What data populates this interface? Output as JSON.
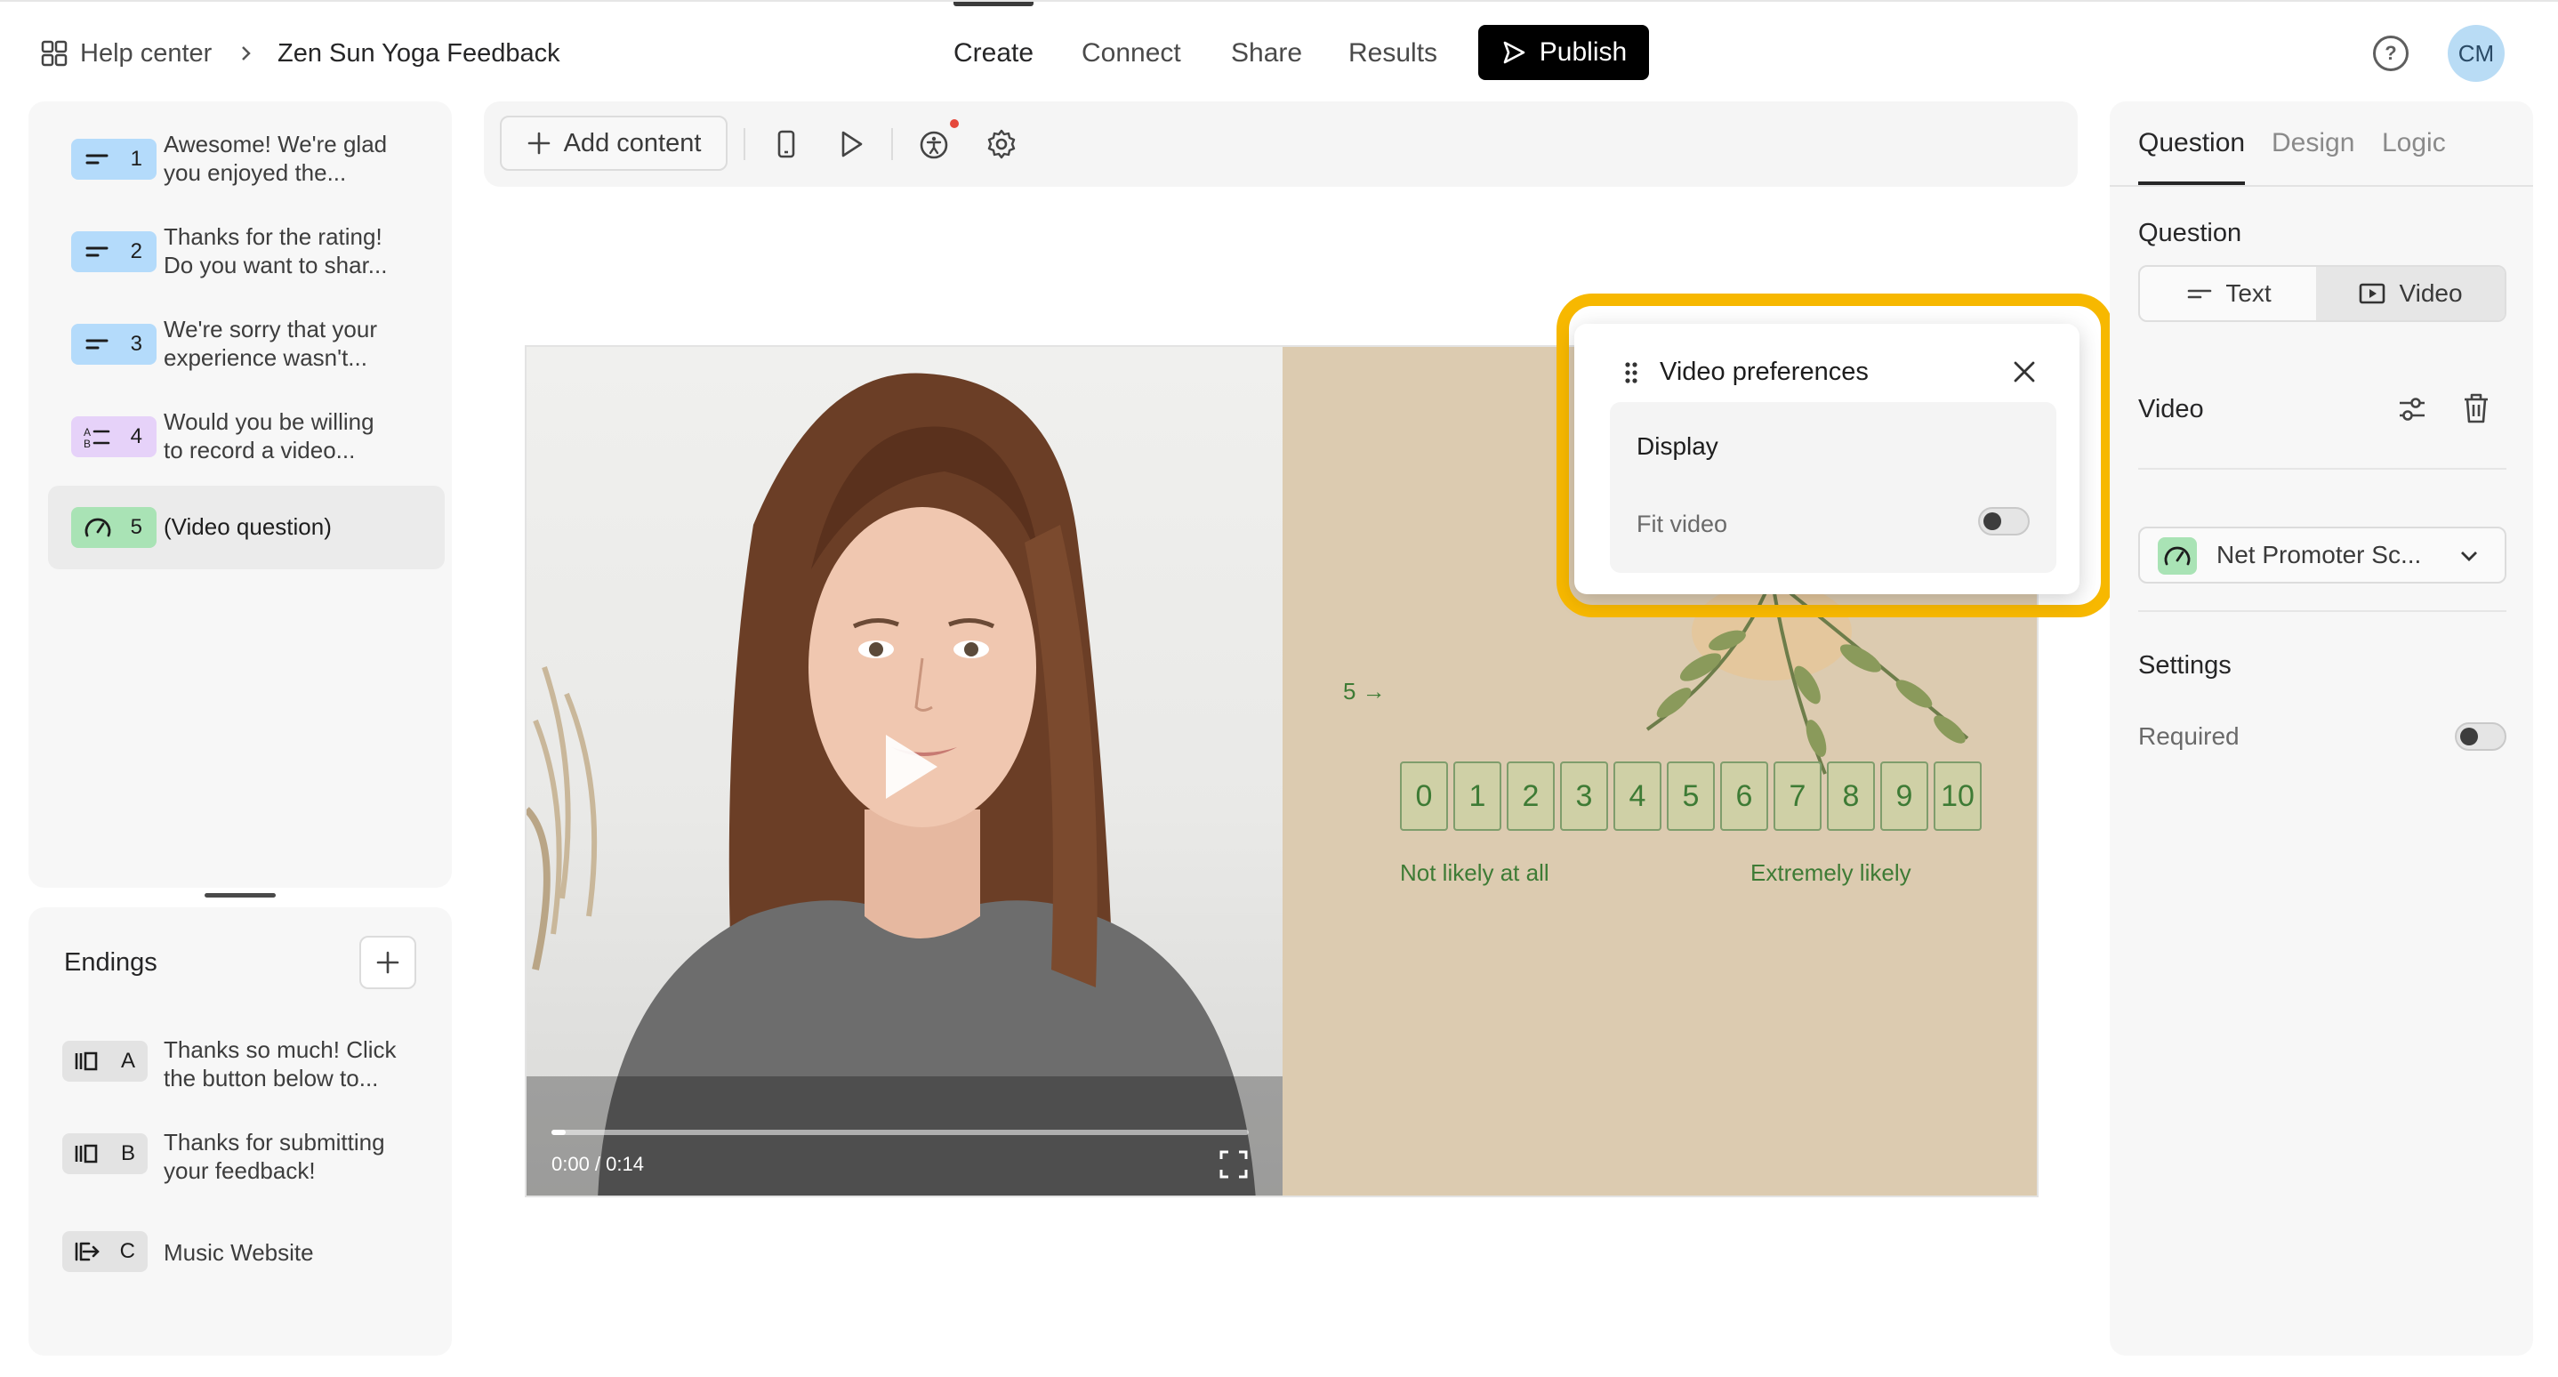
{
  "header": {
    "help_center": "Help center",
    "form_title": "Zen Sun Yoga Feedback",
    "nav": [
      "Create",
      "Connect",
      "Share",
      "Results"
    ],
    "publish": "Publish",
    "avatar": "CM"
  },
  "questions": [
    {
      "num": "1",
      "line1": "Awesome! We're glad",
      "line2": "you enjoyed the...",
      "color": "#b4dbfb"
    },
    {
      "num": "2",
      "line1": "Thanks for the rating!",
      "line2": "Do you want to shar...",
      "color": "#b4dbfb"
    },
    {
      "num": "3",
      "line1": "We're sorry that your",
      "line2": "experience wasn't...",
      "color": "#b4dbfb"
    },
    {
      "num": "4",
      "line1": "Would you be willing",
      "line2": "to record a video...",
      "color": "#e6d2f9"
    },
    {
      "num": "5",
      "line1": "(Video question)",
      "line2": "",
      "color": "#a9e3b5"
    }
  ],
  "endings": {
    "title": "Endings",
    "items": [
      {
        "letter": "A",
        "line1": "Thanks so much! Click",
        "line2": "the button below to..."
      },
      {
        "letter": "B",
        "line1": "Thanks for submitting",
        "line2": "your feedback!"
      },
      {
        "letter": "C",
        "line1": "Music Website",
        "line2": ""
      }
    ]
  },
  "toolbar": {
    "add_content": "Add content"
  },
  "canvas": {
    "video_time": "0:00 / 0:14",
    "question_number": "5 →",
    "nps_scale": [
      "0",
      "1",
      "2",
      "3",
      "4",
      "5",
      "6",
      "7",
      "8",
      "9",
      "10"
    ],
    "label_low": "Not likely at all",
    "label_high": "Extremely likely",
    "accent": "#3e7b35"
  },
  "video_preferences": {
    "title": "Video preferences",
    "section": "Display",
    "fit_video_label": "Fit video",
    "fit_video_on": false
  },
  "right_panel": {
    "tabs": [
      "Question",
      "Design",
      "Logic"
    ],
    "question_heading": "Question",
    "segment": [
      "Text",
      "Video"
    ],
    "video_heading": "Video",
    "question_type": "Net Promoter Sc...",
    "settings_heading": "Settings",
    "required_label": "Required",
    "required_on": false
  }
}
